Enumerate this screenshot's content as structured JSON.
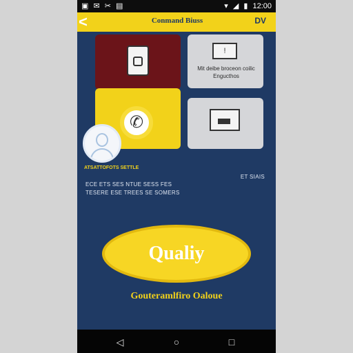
{
  "status_bar": {
    "left_icons": "▣ ✉ ✂ ▤",
    "right_icons": [
      "▾",
      "◢",
      "▮",
      "12:00"
    ]
  },
  "header": {
    "back_icon": "<",
    "title": "Conmand Biuss",
    "action_label": "DV"
  },
  "tiles": {
    "gray1_text": "Mit deibe broceon coilic Engucthos"
  },
  "profile": {
    "caption": "ATSATTOFOTS SETTLE"
  },
  "info": {
    "line1": "ET SIAIS",
    "line2": "ECE ETS SES NTUE SESS FES",
    "line3": "TESERE ESE TREES SE SOMERS"
  },
  "cta": {
    "button_label": "Qualiy",
    "caption": "Gouteramlfiro Oaloue"
  },
  "nav": {
    "back": "◁",
    "home": "○",
    "recent": "□"
  },
  "colors": {
    "accent": "#f2d21a",
    "background": "#1f3a64",
    "maroon": "#6b1419",
    "tile_gray": "#d5d6d9"
  }
}
